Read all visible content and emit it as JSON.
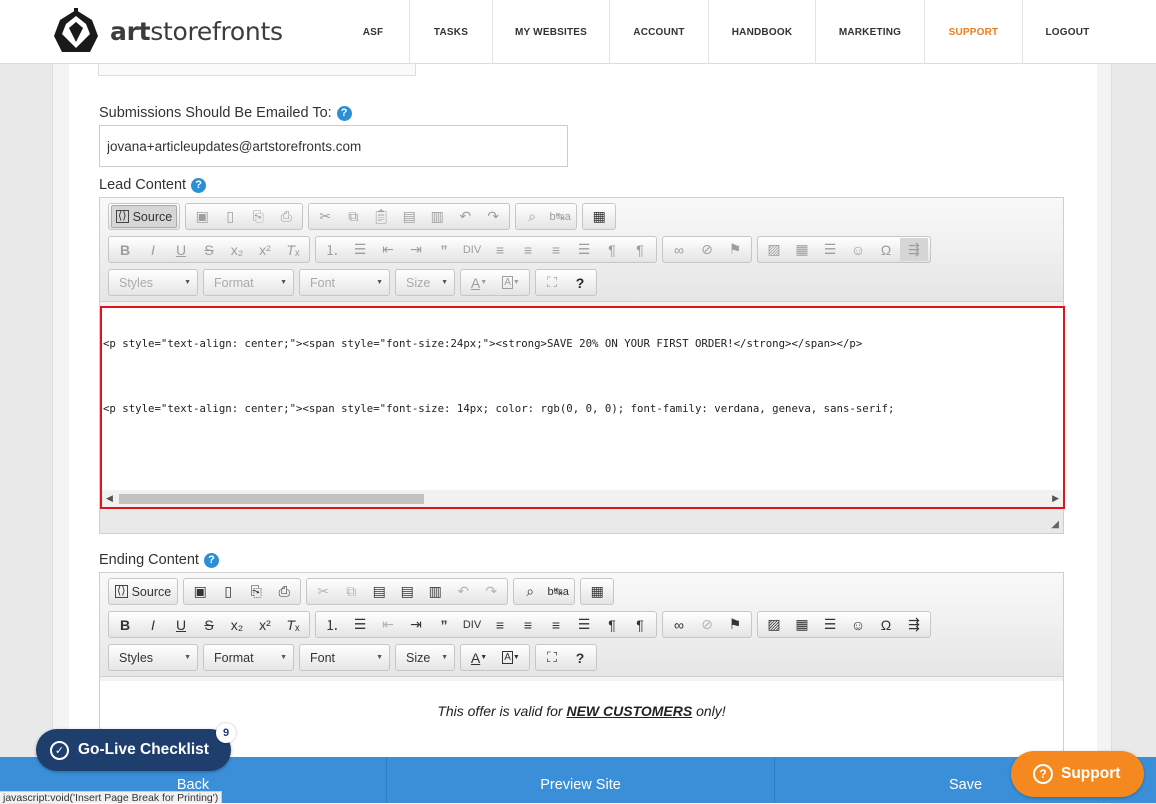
{
  "brand": {
    "name_bold": "art",
    "name_rest": "storefronts"
  },
  "nav": [
    {
      "label": "ASF",
      "active": false
    },
    {
      "label": "TASKS",
      "active": false
    },
    {
      "label": "MY WEBSITES",
      "active": false
    },
    {
      "label": "ACCOUNT",
      "active": false
    },
    {
      "label": "HANDBOOK",
      "active": false
    },
    {
      "label": "MARKETING",
      "active": false
    },
    {
      "label": "SUPPORT",
      "active": true
    },
    {
      "label": "LOGOUT",
      "active": false
    }
  ],
  "form": {
    "email_label": "Submissions Should Be Emailed To:",
    "email_value": "jovana+articleupdates@artstorefronts.com",
    "lead_label": "Lead Content",
    "ending_label": "Ending Content",
    "help_glyph": "?"
  },
  "toolbar": {
    "source_label": "Source",
    "styles_label": "Styles",
    "format_label": "Format",
    "font_label": "Font",
    "size_label": "Size"
  },
  "lead_editor": {
    "mode": "source",
    "source_lines": [
      "<p style=\"text-align: center;\"><span style=\"font-size:24px;\"><strong>SAVE 20% ON YOUR FIRST ORDER!</strong></span></p>",
      "<p style=\"text-align: center;\"><span style=\"font-size: 14px; color: rgb(0, 0, 0); font-family: verdana, geneva, sans-serif;"
    ]
  },
  "ending_editor": {
    "mode": "wysiwyg",
    "text_before": "This offer is valid for ",
    "text_emph": "NEW CUSTOMERS",
    "text_after": " only!"
  },
  "bottom_bar": {
    "back": "Back",
    "preview": "Preview Site",
    "save": "Save"
  },
  "golive": {
    "label": "Go-Live Checklist",
    "badge": "9"
  },
  "support": {
    "label": "Support"
  },
  "status_url": "javascript:void('Insert Page Break for Printing')",
  "colors": {
    "accent_orange": "#f07c1e",
    "bar_blue": "#3a8fd8",
    "golive_navy": "#1e3e6e",
    "highlight_red": "#e3121b",
    "help_blue": "#2b8fd6"
  },
  "icons": [
    "logo-mark",
    "help-icon",
    "source-icon",
    "save-icon",
    "new-page-icon",
    "preview-icon",
    "print-icon",
    "cut-icon",
    "copy-icon",
    "paste-icon",
    "paste-text-icon",
    "paste-word-icon",
    "undo-icon",
    "redo-icon",
    "find-icon",
    "replace-icon",
    "select-all-icon",
    "bold-icon",
    "italic-icon",
    "underline-icon",
    "strike-icon",
    "subscript-icon",
    "superscript-icon",
    "remove-format-icon",
    "numbered-list-icon",
    "bulleted-list-icon",
    "outdent-icon",
    "indent-icon",
    "blockquote-icon",
    "div-icon",
    "align-left-icon",
    "align-center-icon",
    "align-right-icon",
    "justify-icon",
    "ltr-icon",
    "rtl-icon",
    "link-icon",
    "unlink-icon",
    "anchor-icon",
    "image-icon",
    "table-icon",
    "hr-icon",
    "smiley-icon",
    "special-char-icon",
    "page-break-icon",
    "text-color-icon",
    "bg-color-icon",
    "maximize-icon",
    "about-icon",
    "check-circle-icon",
    "question-circle-icon"
  ]
}
